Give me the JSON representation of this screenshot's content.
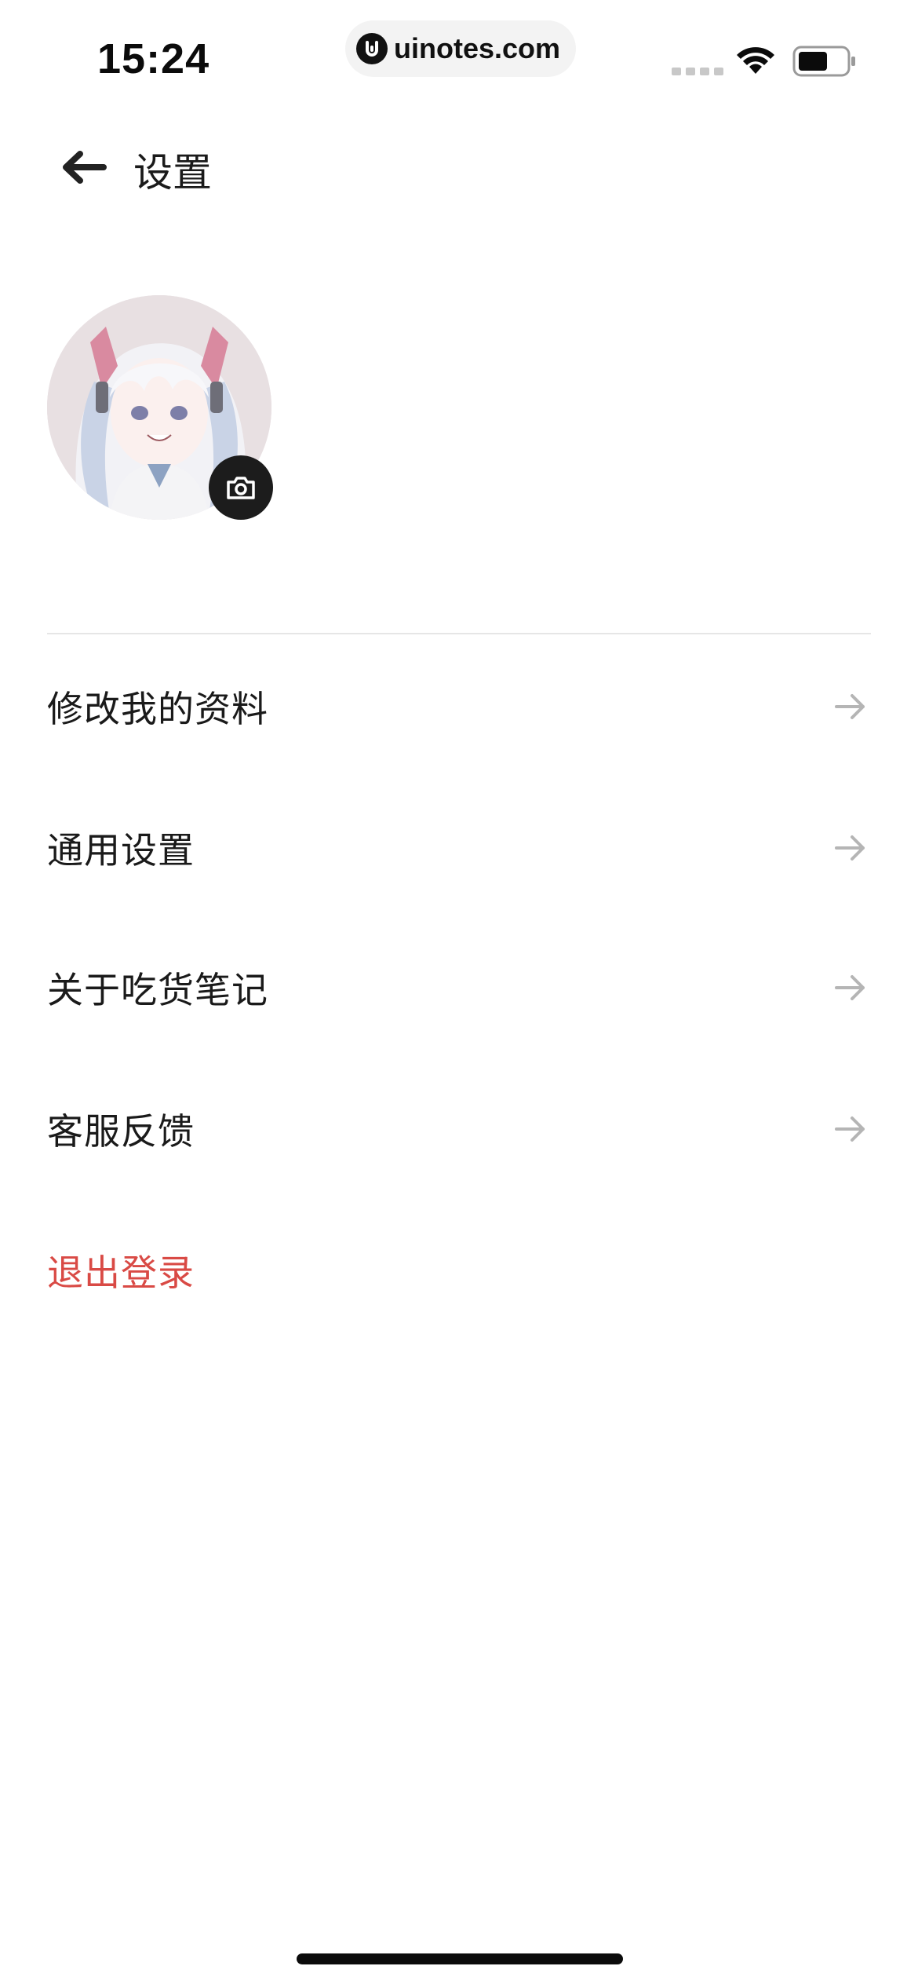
{
  "status_bar": {
    "time": "15:24",
    "url": "uinotes.com",
    "icons": [
      "signal-icon",
      "wifi-icon",
      "battery-icon"
    ]
  },
  "header": {
    "back_icon": "arrow-left-icon",
    "title": "设置"
  },
  "profile": {
    "avatar_icon": "avatar-image",
    "camera_icon": "camera-icon"
  },
  "menu": {
    "items": [
      {
        "label": "修改我的资料",
        "icon": "arrow-right-icon"
      },
      {
        "label": "通用设置",
        "icon": "arrow-right-icon"
      },
      {
        "label": "关于吃货笔记",
        "icon": "arrow-right-icon"
      },
      {
        "label": "客服反馈",
        "icon": "arrow-right-icon"
      }
    ],
    "logout_label": "退出登录"
  },
  "colors": {
    "logout": "#d94a45",
    "arrow": "#b5b5b5",
    "text": "#1a1a1a"
  }
}
